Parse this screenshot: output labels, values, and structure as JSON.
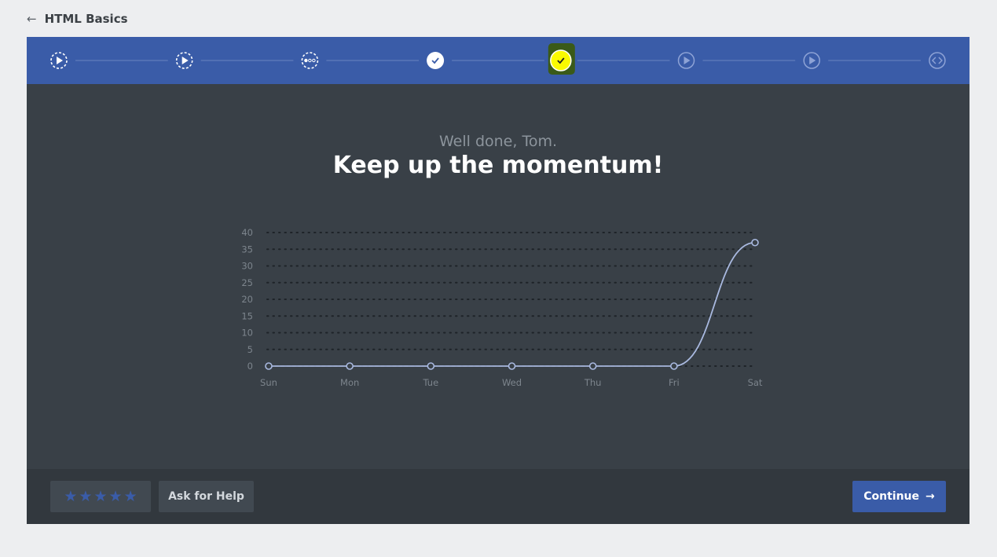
{
  "header": {
    "back_icon": "arrow-left-icon",
    "title": "HTML Basics"
  },
  "progress": {
    "steps": [
      {
        "icon": "play-icon",
        "state": "dashed"
      },
      {
        "icon": "play-icon",
        "state": "dashed"
      },
      {
        "icon": "dots-icon",
        "state": "dashed"
      },
      {
        "icon": "check-icon",
        "state": "completed"
      },
      {
        "icon": "check-icon",
        "state": "current"
      },
      {
        "icon": "play-icon",
        "state": "upcoming"
      },
      {
        "icon": "play-icon",
        "state": "upcoming"
      },
      {
        "icon": "code-icon",
        "state": "upcoming"
      }
    ]
  },
  "message": {
    "greeting": "Well done, Tom.",
    "headline": "Keep up the momentum!"
  },
  "chart_data": {
    "type": "line",
    "categories": [
      "Sun",
      "Mon",
      "Tue",
      "Wed",
      "Thu",
      "Fri",
      "Sat"
    ],
    "values": [
      0,
      0,
      0,
      0,
      0,
      0,
      37
    ],
    "ylim": [
      0,
      40
    ],
    "yticks": [
      0,
      5,
      10,
      15,
      20,
      25,
      30,
      35,
      40
    ],
    "grid": true,
    "colors": {
      "line": "#a9b9e0",
      "grid": "#1e2328",
      "labels": "#7d858d"
    }
  },
  "footer": {
    "rating_stars": 5,
    "help_label": "Ask for Help",
    "continue_label": "Continue",
    "continue_icon": "arrow-right-icon"
  },
  "colors": {
    "accent": "#3a5ca8",
    "panel": "#394047",
    "footer": "#32383e",
    "highlight": "#fafa00",
    "highlight_shadow": "#3a5a18"
  }
}
